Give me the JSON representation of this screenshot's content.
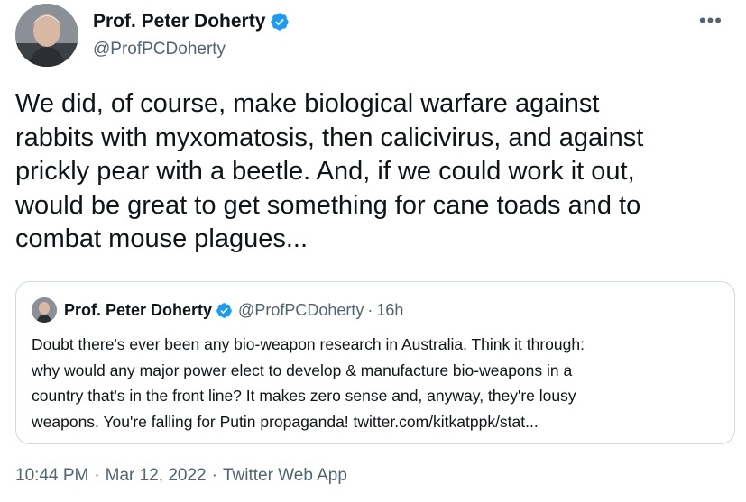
{
  "author": {
    "display_name": "Prof. Peter Doherty",
    "handle": "@ProfPCDoherty",
    "verified": true
  },
  "more_icon": "more-horizontal-icon",
  "tweet": {
    "text": "We did, of course, make biological warfare against\nrabbits with myxomatosis, then calicivirus, and against\nprickly pear with a beetle. And, if we could work it out,\nwould be great to get something for cane toads and to\ncombat mouse plagues..."
  },
  "quoted_tweet": {
    "display_name": "Prof. Peter Doherty",
    "handle": "@ProfPCDoherty",
    "separator": "·",
    "time_ago": "16h",
    "text": "Doubt there's ever been any bio-weapon research in Australia. Think it through:\nwhy would any major power elect to develop & manufacture bio-weapons in a\ncountry that's in the front line? It makes zero sense and, anyway, they're lousy\nweapons. You're falling for Putin propaganda! twitter.com/kitkatppk/stat..."
  },
  "meta": {
    "time": "10:44 PM",
    "date": "Mar 12, 2022",
    "source": "Twitter Web App",
    "separator": "·"
  },
  "colors": {
    "text": "#0f1419",
    "secondary": "#536471",
    "verified_blue": "#1d9bf0",
    "border": "#cfd9de"
  }
}
